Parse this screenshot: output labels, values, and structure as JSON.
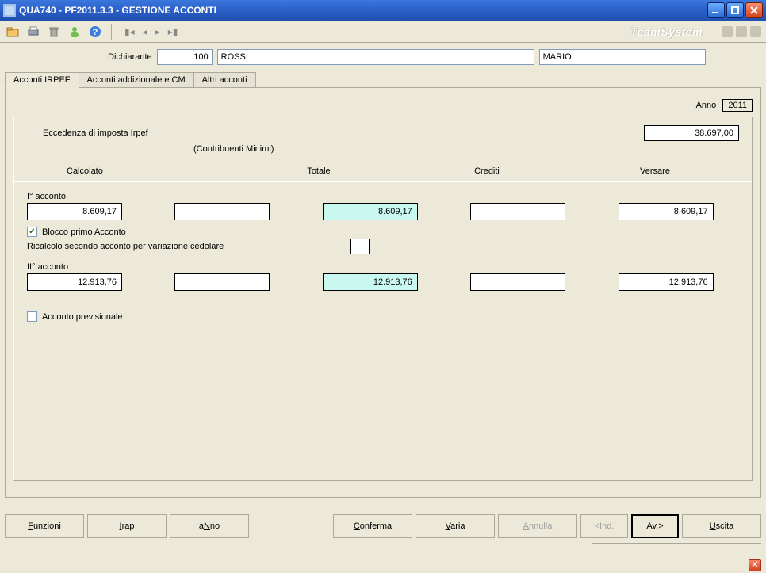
{
  "window": {
    "title": "QUA740  - PF2011.3.3  -  GESTIONE ACCONTI"
  },
  "brand": "TeamSystem",
  "declarant": {
    "label": "Dichiarante",
    "code": "100",
    "surname": "ROSSI",
    "name": "MARIO"
  },
  "tabs": {
    "t1": "Acconti IRPEF",
    "t2": "Acconti addizionale e CM",
    "t3": "Altri acconti"
  },
  "year": {
    "label": "Anno",
    "value": "2011"
  },
  "excess": {
    "label": "Eccedenza di imposta Irpef",
    "value": "38.697,00",
    "note": "(Contribuenti Minimi)"
  },
  "columns": {
    "c1": "Calcolato",
    "c2": "Totale",
    "c3": "Crediti",
    "c4": "Versare"
  },
  "acc1": {
    "label": "I°  acconto",
    "calcolato": "8.609,17",
    "blank1": "",
    "totale": "8.609,17",
    "crediti": "",
    "versare": "8.609,17"
  },
  "blocco": {
    "label": "Blocco primo Acconto"
  },
  "ricalcolo": {
    "label": "Ricalcolo secondo acconto per variazione cedolare",
    "value": ""
  },
  "acc2": {
    "label": "II° acconto",
    "calcolato": "12.913,76",
    "blank1": "",
    "totale": "12.913,76",
    "crediti": "",
    "versare": "12.913,76"
  },
  "prev": {
    "label": "Acconto previsionale"
  },
  "buttons": {
    "funzioni": "Funzioni",
    "irap": "Irap",
    "anno": "aNno",
    "conferma": "Conferma",
    "varia": "Varia",
    "annulla": "Annulla",
    "ind": "<Ind.",
    "av": "Av.>",
    "uscita": "Uscita"
  }
}
